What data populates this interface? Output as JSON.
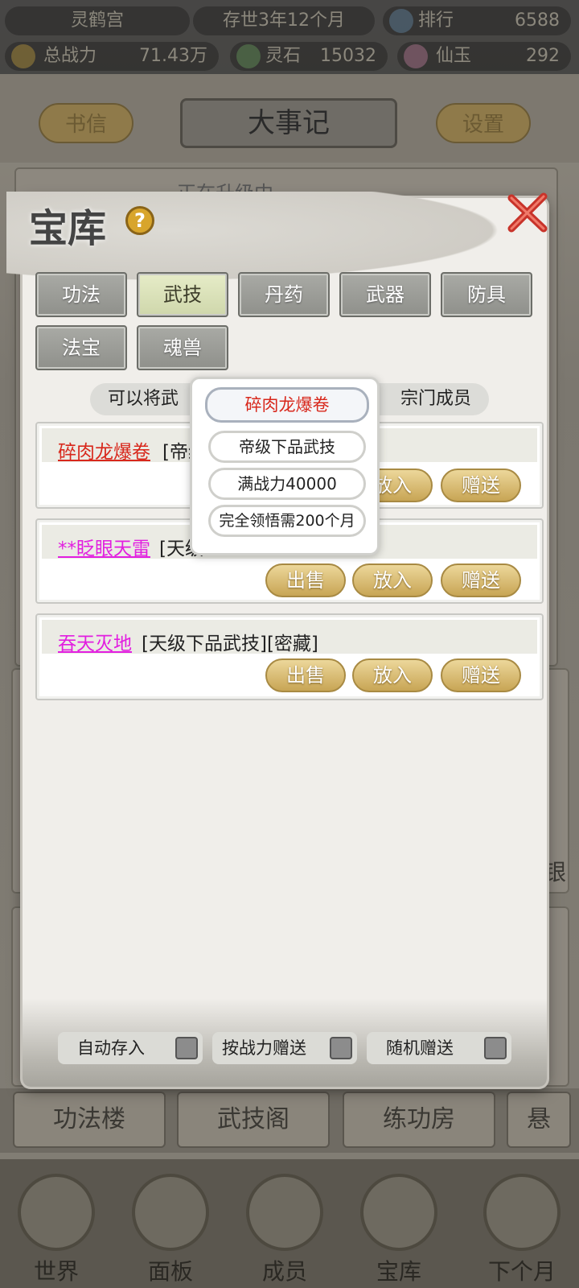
{
  "topbar": {
    "sect_name": "灵鹤宫",
    "time": "存世3年12个月",
    "rank_label": "排行",
    "rank_value": "6588",
    "power_label": "总战力",
    "power_value": "71.43万",
    "spirit_stone_label": "灵石",
    "spirit_stone_value": "15032",
    "jade_label": "仙玉",
    "jade_value": "292"
  },
  "header": {
    "letters_button": "书信",
    "title": "大事记",
    "settings_button": "设置"
  },
  "background": {
    "ticker_text": "正在升级中",
    "side_text": "银",
    "bottom_tabs": [
      "功法楼",
      "武技阁",
      "练功房",
      "悬"
    ],
    "nav": [
      "世界",
      "面板",
      "成员",
      "宝库",
      "下个月"
    ]
  },
  "treasury": {
    "title": "宝库",
    "help_icon": "?",
    "tabs": [
      "功法",
      "武技",
      "丹药",
      "武器",
      "防具",
      "法宝",
      "魂兽"
    ],
    "active_tab": "武技",
    "info_left": "可以将武",
    "info_right": "宗门成员",
    "items": [
      {
        "name": "碎肉龙爆卷",
        "tags": "[帝级",
        "name_color": "#d8281c",
        "buttons": [
          "放入",
          "赠送"
        ]
      },
      {
        "name": "**眨眼天雷",
        "tags": "[天级",
        "name_color": "#e21ee0",
        "buttons": [
          "出售",
          "放入",
          "赠送"
        ]
      },
      {
        "name": "吞天灭地",
        "tags": "[天级下品武技][密藏]",
        "name_color": "#e21ee0",
        "buttons": [
          "出售",
          "放入",
          "赠送"
        ]
      }
    ],
    "bottom_options": [
      "自动存入",
      "按战力赠送",
      "随机赠送"
    ]
  },
  "tooltip": {
    "title": "碎肉龙爆卷",
    "grade": "帝级下品武技",
    "requirement": "满战力40000",
    "comprehend": "完全领悟需200个月"
  }
}
